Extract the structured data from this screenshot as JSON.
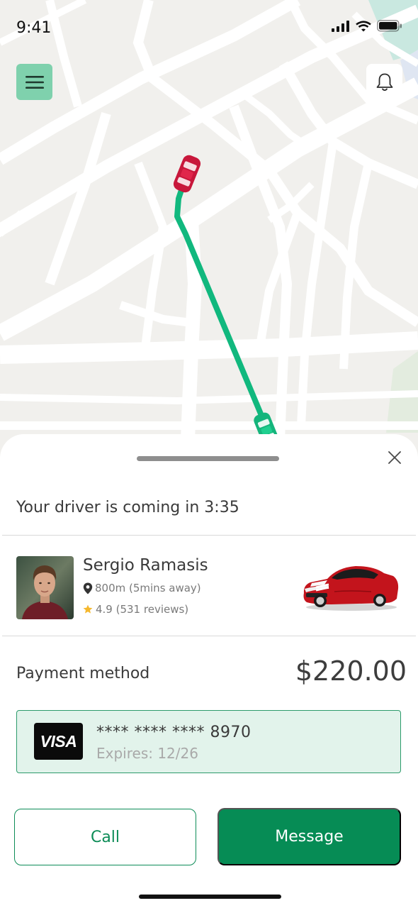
{
  "status_bar": {
    "time": "9:41"
  },
  "trip": {
    "eta_text": "Your driver is coming in 3:35"
  },
  "driver": {
    "name": "Sergio Ramasis",
    "distance": "800m (5mins away)",
    "rating": "4.9 (531 reviews)"
  },
  "payment": {
    "label": "Payment method",
    "amount": "$220.00",
    "card_brand": "VISA",
    "card_number": "**** **** **** 8970",
    "card_expiry": "Expires: 12/26"
  },
  "actions": {
    "call": "Call",
    "message": "Message"
  },
  "icons": [
    "signal-icon",
    "wifi-icon",
    "battery-icon",
    "menu-icon",
    "bell-icon",
    "close-icon",
    "location-pin-icon",
    "star-icon"
  ],
  "colors": {
    "primary": "#068c55",
    "route": "#11b87e",
    "menu_bg": "#7fd1ad",
    "card_bg": "#e2f3eb",
    "star": "#f5b82e"
  }
}
